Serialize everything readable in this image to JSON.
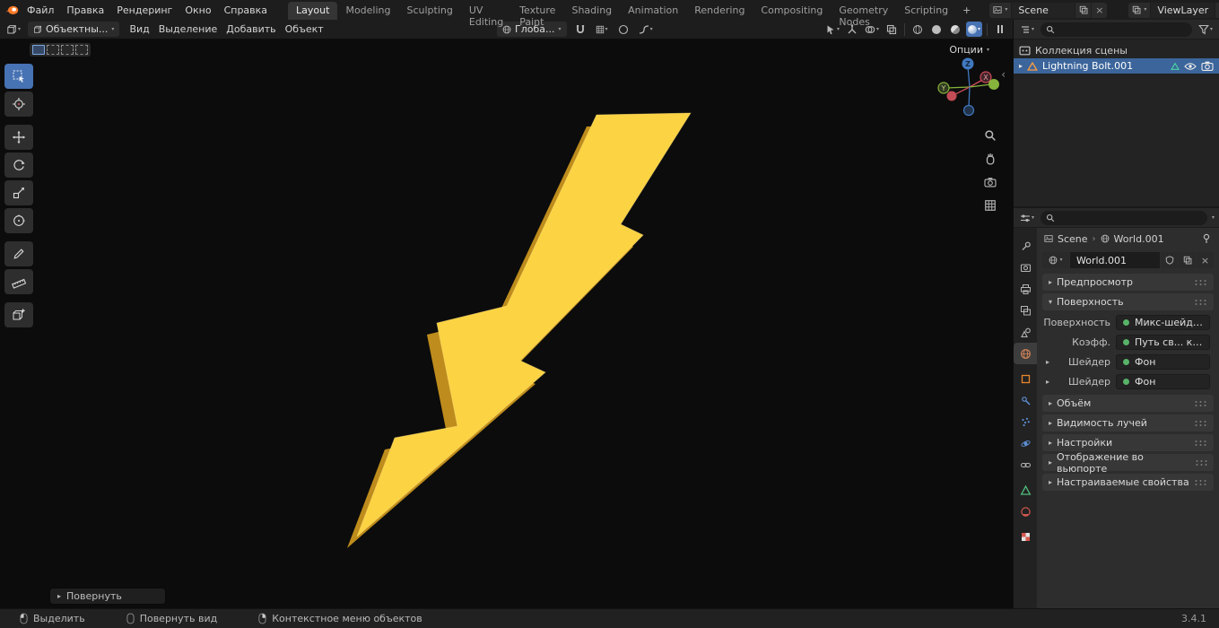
{
  "icons": {
    "dropdown": "▾",
    "disclosure_closed": "▸",
    "disclosure_open": "▾",
    "breadcrumb_separator": "›",
    "close": "×",
    "collapse_left": "‹"
  },
  "topbar": {
    "menus": [
      "Файл",
      "Правка",
      "Рендеринг",
      "Окно",
      "Справка"
    ],
    "tabs": [
      "Layout",
      "Modeling",
      "Sculpting",
      "UV Editing",
      "Texture Paint",
      "Shading",
      "Animation",
      "Rendering",
      "Compositing",
      "Geometry Nodes",
      "Scripting"
    ],
    "active_tab": "Layout",
    "add_tab_label": "+",
    "scene_selector": {
      "value": "Scene"
    },
    "viewlayer_selector": {
      "value": "ViewLayer"
    }
  },
  "viewport": {
    "header": {
      "mode_value": "Объектны...",
      "menus": [
        "Вид",
        "Выделение",
        "Добавить",
        "Объект"
      ],
      "orientation_value": "Глоба...",
      "options_label": "Опции"
    },
    "gizmo_axes": {
      "x": "X",
      "y": "Y",
      "z": "Z"
    },
    "operator_panel_label": "Повернуть",
    "colors": {
      "bolt_front": "#FBD343",
      "bolt_side": "#BE8C1C",
      "background": "#0c0c0c",
      "accent": "#4772b3"
    }
  },
  "outliner": {
    "rows": [
      {
        "label": "Коллекция сцены",
        "type": "collection"
      },
      {
        "label": "Lightning Bolt.001",
        "type": "mesh",
        "selected": true
      }
    ]
  },
  "properties": {
    "breadcrumb": {
      "scene": "Scene",
      "world": "World.001"
    },
    "datablock_name": "World.001",
    "sections": {
      "preview": "Предпросмотр",
      "surface": "Поверхность",
      "volume": "Объём",
      "ray_visibility": "Видимость лучей",
      "settings": "Настройки",
      "viewport_display": "Отображение во вьюпорте",
      "custom_props": "Настраиваемые свойства"
    },
    "surface_rows": [
      {
        "label": "Поверхность",
        "value": "Микс-шейдер"
      },
      {
        "label": "Коэфф.",
        "value": "Путь св... камеры"
      },
      {
        "label": "Шейдер",
        "value": "Фон"
      },
      {
        "label": "Шейдер",
        "value": "Фон"
      }
    ]
  },
  "statusbar": {
    "keymap_items": [
      {
        "label": "Выделить"
      },
      {
        "label": "Повернуть вид"
      },
      {
        "label": "Контекстное меню объектов"
      }
    ],
    "version": "3.4.1"
  }
}
